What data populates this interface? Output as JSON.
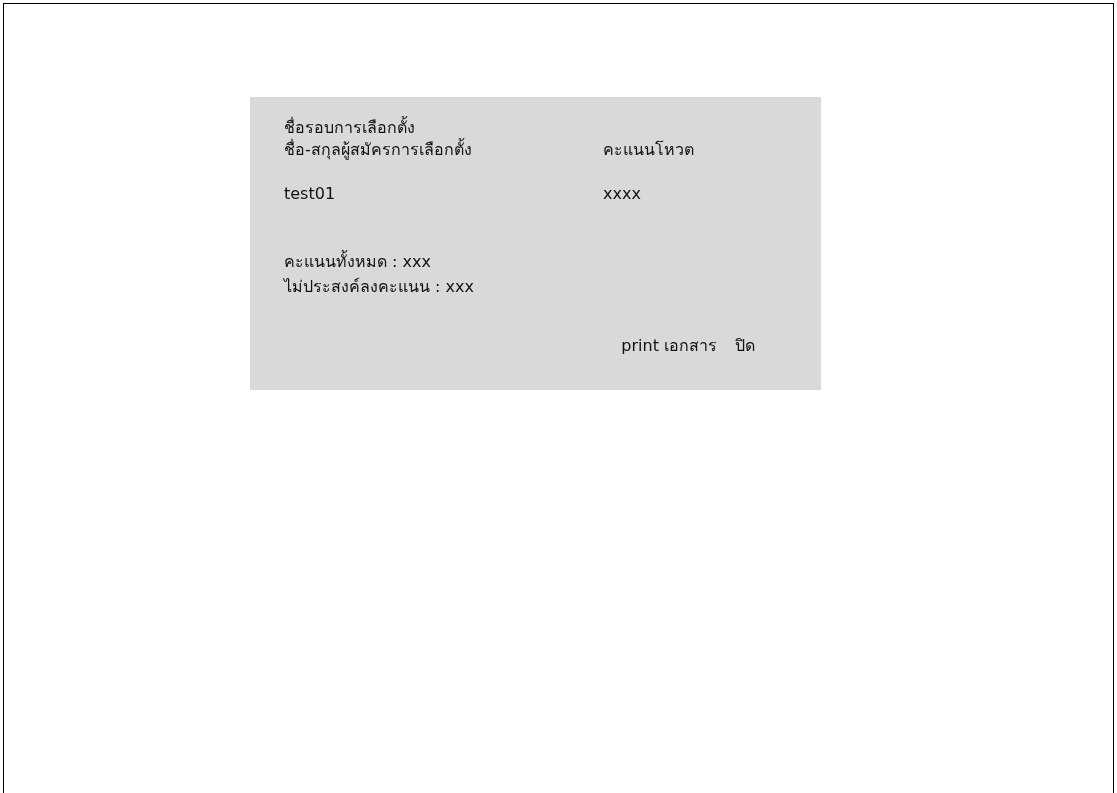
{
  "dialog": {
    "title": "ชื่อรอบการเลือกตั้ง",
    "columns": [
      "ชื่อ-สกุลผู้สมัครการเลือกตั้ง",
      "คะแนนโหวต"
    ],
    "rows": [
      [
        "test01",
        "xxxx"
      ]
    ],
    "summary": [
      "คะแนนทั้งหมด : xxx",
      "ไม่ประสงค์ลงคะแนน : xxx"
    ],
    "buttons": [
      "print เอกสาร",
      "ปิด"
    ]
  }
}
